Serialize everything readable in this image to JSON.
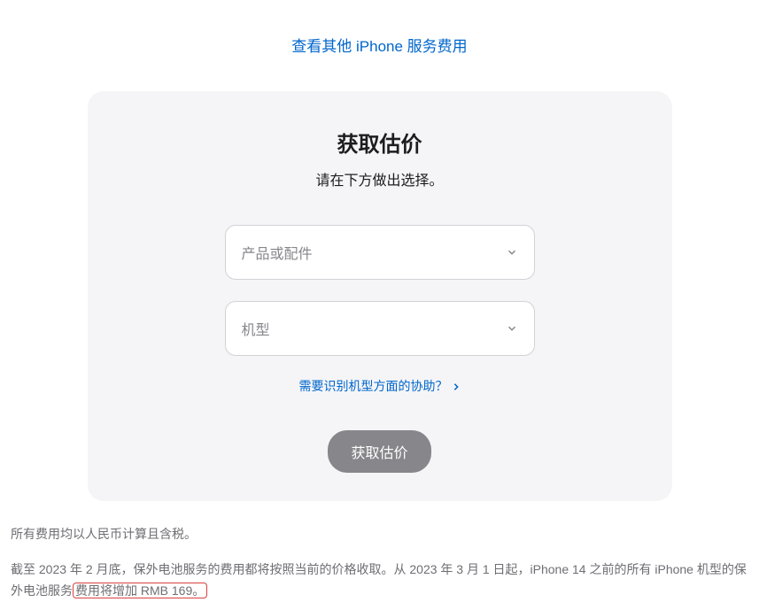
{
  "topLink": {
    "text": "查看其他 iPhone 服务费用"
  },
  "card": {
    "title": "获取估价",
    "subtitle": "请在下方做出选择。",
    "selectProduct": {
      "placeholder": "产品或配件"
    },
    "selectModel": {
      "placeholder": "机型"
    },
    "helpLink": {
      "text": "需要识别机型方面的协助？"
    },
    "button": {
      "label": "获取估价"
    }
  },
  "notes": {
    "line1": "所有费用均以人民币计算且含税。",
    "line2_part1": "截至 2023 年 2 月底，保外电池服务的费用都将按照当前的价格收取。从 2023 年 3 月 1 日起，iPhone 14 之前的所有 iPhone 机型的保外电池服务",
    "line2_highlight": "费用将增加 RMB 169。"
  }
}
